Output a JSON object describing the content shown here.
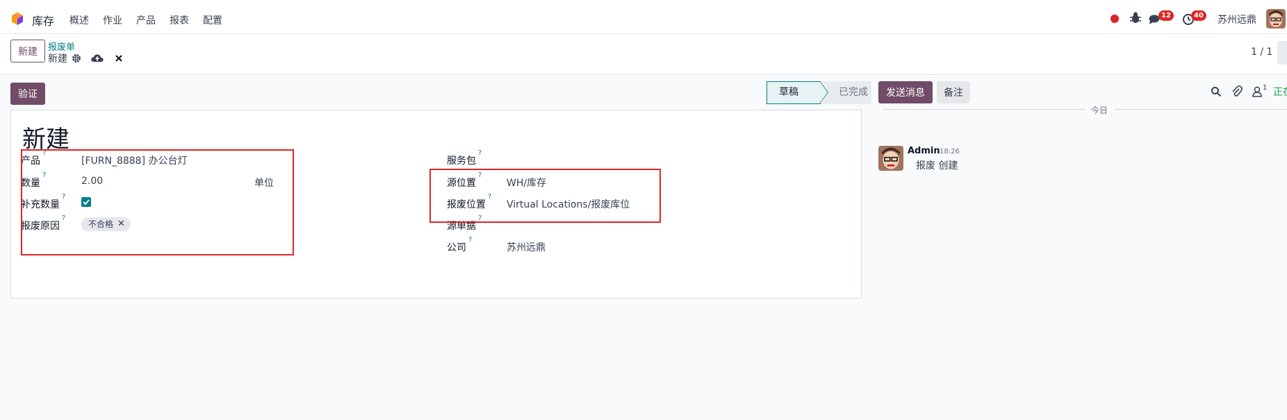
{
  "navbar": {
    "app_name": "库存",
    "menu": [
      "概述",
      "作业",
      "产品",
      "报表",
      "配置"
    ],
    "messages_count": "12",
    "activities_count": "40",
    "company": "苏州远鼎"
  },
  "control": {
    "new_button": "新建",
    "breadcrumb": "报废单",
    "record_name": "新建",
    "pager": "1 / 1"
  },
  "statusbar": {
    "validate_button": "验证",
    "stages": [
      "草稿",
      "已完成"
    ],
    "active_stage": "草稿"
  },
  "form": {
    "title": "新建",
    "help_mark": "?",
    "left": {
      "product_label": "产品",
      "product_value": "[FURN_8888] 办公台灯",
      "quantity_label": "数量",
      "quantity_value": "2.00",
      "uom_label": "单位",
      "replenish_label": "补充数量",
      "replenish_checked": true,
      "reason_label": "报废原因",
      "reason_tag": "不合格"
    },
    "right": {
      "package_label": "服务包",
      "source_location_label": "源位置",
      "source_location_value": "WH/库存",
      "scrap_location_label": "报废位置",
      "scrap_location_value": "Virtual Locations/报废库位",
      "source_document_label": "源单据",
      "company_label": "公司",
      "company_value": "苏州远鼎"
    }
  },
  "chatter": {
    "send_button": "发送消息",
    "note_button": "备注",
    "followers_count": "1",
    "follow_text": "正在",
    "today": "今日",
    "message": {
      "author": "Admin",
      "time": "18:26",
      "body": "报废 创建"
    }
  },
  "colors": {
    "primary": "#714b67",
    "teal": "#017e84",
    "annotation": "#dc2626"
  }
}
